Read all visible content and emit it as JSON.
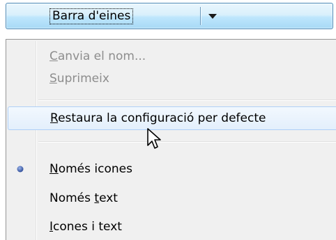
{
  "toolbar": {
    "split_button_label": "Barra d'eines",
    "dropdown_icon": "chevron-down-icon"
  },
  "menu": {
    "items": [
      {
        "pre": "",
        "mnemonic": "C",
        "post": "anvia el nom...",
        "enabled": false
      },
      {
        "pre": "",
        "mnemonic": "S",
        "post": "uprimeix",
        "enabled": false
      },
      {
        "pre": "",
        "mnemonic": "R",
        "post": "estaura la configuració per defecte",
        "enabled": true,
        "highlighted": true
      },
      {
        "pre": "",
        "mnemonic": "N",
        "post": "omés icones",
        "enabled": true,
        "checked": true
      },
      {
        "pre": "Només ",
        "mnemonic": "t",
        "post": "ext",
        "enabled": true
      },
      {
        "pre": "",
        "mnemonic": "I",
        "post": "cones i text",
        "enabled": true
      }
    ]
  },
  "colors": {
    "button_border": "#4d8ab6",
    "disabled_text": "#8d8d8d",
    "highlight_border": "#aecff7",
    "radio_bullet": "#3b5da8"
  },
  "cursor_icon": "arrow-pointer-icon"
}
